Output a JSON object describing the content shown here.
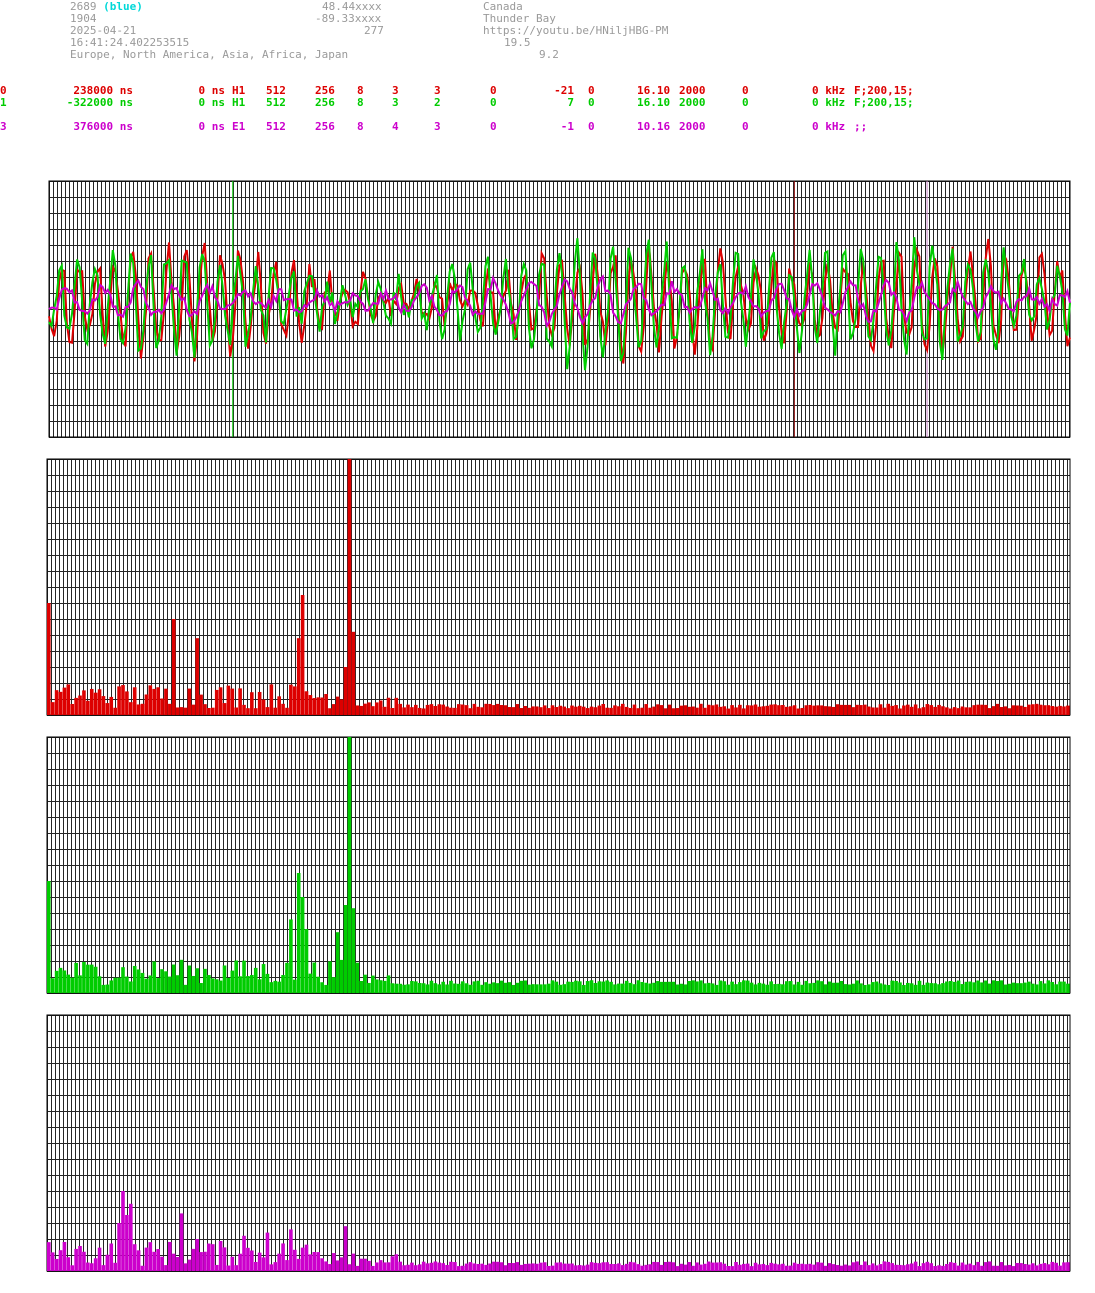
{
  "header": {
    "station_id": "2689",
    "station_color": "(blue)",
    "line2": "1904",
    "date": "2025-04-21",
    "time": "16:41:24.402253515",
    "regions": "Europe, North America, Asia, Africa, Japan",
    "lat": "48.44xxxx",
    "lon": "-89.33xxxx",
    "alt": "277",
    "country": "Canada",
    "city": "Thunder Bay",
    "url": "https://youtu.be/HNiljHBG-PM",
    "val1": "19.5",
    "val2": "9.2"
  },
  "channels": [
    {
      "idx": "0",
      "offset": "238000 ns",
      "zero": "0 ns",
      "type": "H1",
      "n512": "512",
      "n256": "256",
      "n8": "8",
      "a": "3",
      "b": "3",
      "c": "0",
      "d": "-21",
      "e": "0",
      "f": "16.10",
      "g": "2000",
      "h": "0",
      "khz": "0 kHz",
      "filt": "F;200,15;",
      "color": "#dd0000"
    },
    {
      "idx": "1",
      "offset": "-322000 ns",
      "zero": "0 ns",
      "type": "H1",
      "n512": "512",
      "n256": "256",
      "n8": "8",
      "a": "3",
      "b": "2",
      "c": "0",
      "d": "7",
      "e": "0",
      "f": "16.10",
      "g": "2000",
      "h": "0",
      "khz": "0 kHz",
      "filt": "F;200,15;",
      "color": "#00cc00"
    },
    {
      "idx": "3",
      "offset": "376000 ns",
      "zero": "0 ns",
      "type": "E1",
      "n512": "512",
      "n256": "256",
      "n8": "8",
      "a": "4",
      "b": "3",
      "c": "0",
      "d": "-1",
      "e": "0",
      "f": "10.16",
      "g": "2000",
      "h": "0",
      "khz": "0 kHz",
      "filt": ";;",
      "color": "#cc00cc"
    }
  ],
  "chart_data": [
    {
      "type": "line",
      "title": "",
      "series": [
        {
          "color": "#dd0000"
        },
        {
          "color": "#00cc00"
        },
        {
          "color": "#cc00cc"
        }
      ],
      "grid": true,
      "markers": [
        {
          "position": 0.18,
          "color": "#00cc00"
        },
        {
          "position": 0.73,
          "color": "#880000"
        },
        {
          "position": 0.86,
          "color": "#cc88cc"
        }
      ]
    },
    {
      "type": "bar",
      "series_color": "#dd0000",
      "ylim": [
        0,
        16
      ],
      "peaks": [
        {
          "bin": 0,
          "value": 7
        },
        {
          "bin": 32,
          "value": 6
        },
        {
          "bin": 38,
          "value": 4.8
        },
        {
          "bin": 64,
          "value": 4.8
        },
        {
          "bin": 65,
          "value": 7.5
        },
        {
          "bin": 76,
          "value": 3
        },
        {
          "bin": 77,
          "value": 16
        },
        {
          "bin": 78,
          "value": 5.2
        }
      ],
      "baseline": 0.4,
      "bins": 262,
      "grid": true
    },
    {
      "type": "bar",
      "series_color": "#00cc00",
      "ylim": [
        0,
        16
      ],
      "peaks": [
        {
          "bin": 0,
          "value": 7
        },
        {
          "bin": 62,
          "value": 4.6
        },
        {
          "bin": 64,
          "value": 7.5
        },
        {
          "bin": 65,
          "value": 6
        },
        {
          "bin": 66,
          "value": 4
        },
        {
          "bin": 74,
          "value": 3.8
        },
        {
          "bin": 76,
          "value": 5.5
        },
        {
          "bin": 77,
          "value": 16
        },
        {
          "bin": 78,
          "value": 5.3
        }
      ],
      "baseline": 0.5,
      "bins": 262,
      "grid": true
    },
    {
      "type": "bar",
      "series_color": "#cc00cc",
      "ylim": [
        0,
        16
      ],
      "peaks": [
        {
          "bin": 3,
          "value": 1.3
        },
        {
          "bin": 18,
          "value": 3
        },
        {
          "bin": 19,
          "value": 5
        },
        {
          "bin": 20,
          "value": 3.5
        },
        {
          "bin": 21,
          "value": 4.2
        },
        {
          "bin": 34,
          "value": 3.6
        },
        {
          "bin": 38,
          "value": 2
        },
        {
          "bin": 50,
          "value": 2.2
        },
        {
          "bin": 56,
          "value": 2.4
        },
        {
          "bin": 62,
          "value": 2.6
        },
        {
          "bin": 76,
          "value": 2.8
        }
      ],
      "baseline": 0.3,
      "bins": 262,
      "grid": true
    }
  ]
}
